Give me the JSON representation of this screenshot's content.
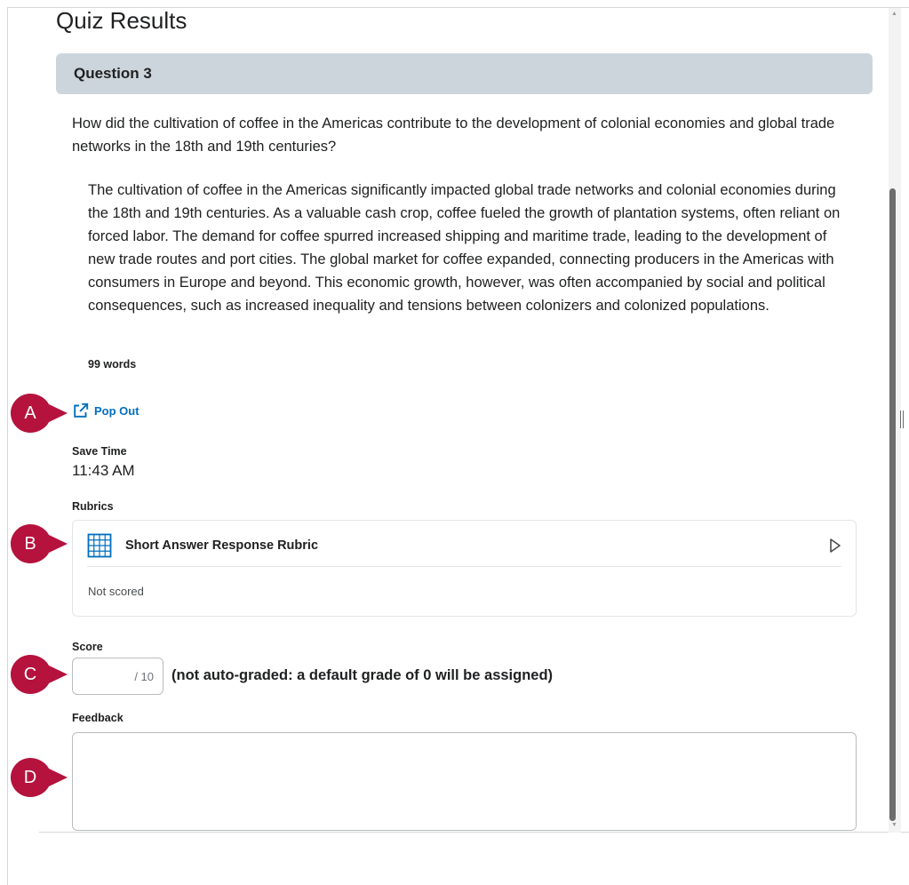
{
  "page": {
    "title": "Quiz Results"
  },
  "question": {
    "header": "Question 3",
    "prompt": "How did the cultivation of coffee in the Americas contribute to the development of colonial economies and global trade networks in the 18th and 19th centuries?",
    "answer": "The cultivation of coffee in the Americas significantly impacted global trade networks and colonial economies during the 18th and 19th centuries. As a valuable cash crop, coffee fueled the growth of plantation systems, often reliant on forced labor. The demand for coffee spurred increased shipping and maritime trade, leading to the development of new trade routes and port cities. The global market for coffee expanded, connecting producers in the Americas with consumers in Europe and beyond. This economic growth, however, was often accompanied by social and political consequences, such as increased inequality and tensions between colonizers and colonized populations.",
    "word_count": "99 words"
  },
  "pop_out": {
    "label": "Pop Out",
    "icon": "external-link-icon"
  },
  "save_time": {
    "label": "Save Time",
    "value": "11:43 AM"
  },
  "rubrics": {
    "label": "Rubrics",
    "items": [
      {
        "title": "Short Answer Response Rubric",
        "status": "Not scored",
        "icon": "grid-icon",
        "expand_icon": "triangle-right-icon"
      }
    ]
  },
  "score": {
    "label": "Score",
    "value": "",
    "max": "/ 10",
    "note": "(not auto-graded: a default grade of 0 will be assigned)"
  },
  "feedback": {
    "label": "Feedback",
    "value": ""
  },
  "callouts": {
    "a": "A",
    "b": "B",
    "c": "C",
    "d": "D"
  },
  "colors": {
    "accent": "#006fbf",
    "callout": "#b5123d",
    "header_bg": "#cdd5dc",
    "text": "#202122"
  }
}
